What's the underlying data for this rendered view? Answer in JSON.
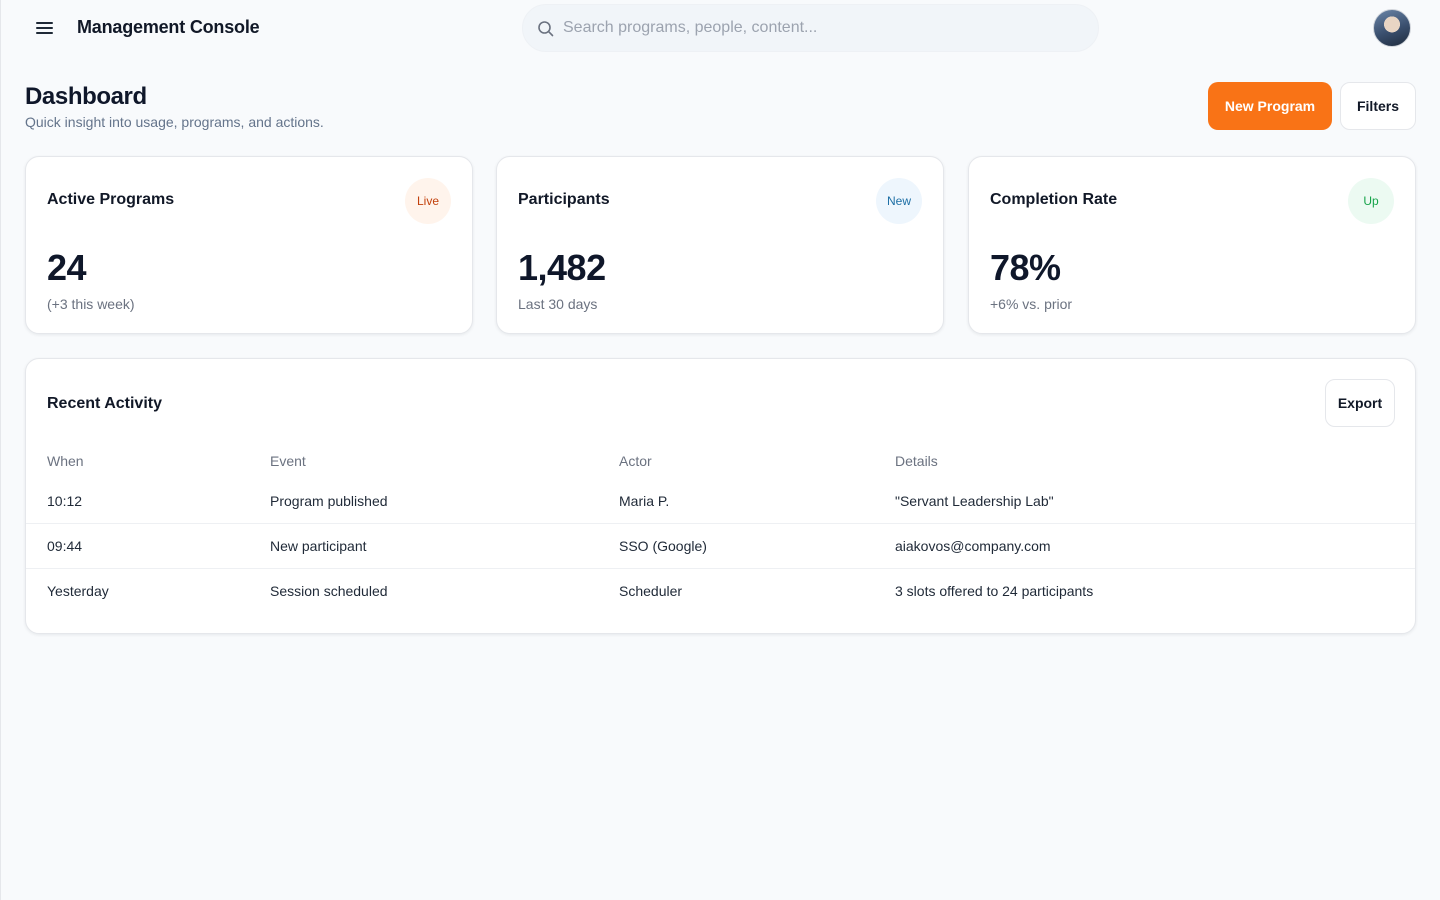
{
  "header": {
    "app_title": "Management Console",
    "search_placeholder": "Search programs, people, content...",
    "menu_icon": "hamburger-menu-icon",
    "search_icon": "search-icon",
    "avatar": "user-avatar"
  },
  "page": {
    "title": "Dashboard",
    "subtitle": "Quick insight into usage, programs, and actions.",
    "new_program_label": "New Program",
    "filters_label": "Filters"
  },
  "colors": {
    "accent": "#f97316",
    "background": "#f8fafc",
    "badge_live": "#c2410c",
    "badge_new": "#1d6fa5",
    "badge_up": "#16a34a"
  },
  "stats": [
    {
      "title": "Active Programs",
      "badge": "Live",
      "value": "24",
      "note": "(+3 this week)"
    },
    {
      "title": "Participants",
      "badge": "New",
      "value": "1,482",
      "note": "Last 30 days"
    },
    {
      "title": "Completion Rate",
      "badge": "Up",
      "value": "78%",
      "note": "+6% vs. prior"
    }
  ],
  "activity": {
    "title": "Recent Activity",
    "export_label": "Export",
    "columns": [
      "When",
      "Event",
      "Actor",
      "Details"
    ],
    "rows": [
      [
        "10:12",
        "Program published",
        "Maria P.",
        "\"Servant Leadership Lab\""
      ],
      [
        "09:44",
        "New participant",
        "SSO (Google)",
        "aiakovos@company.com"
      ],
      [
        "Yesterday",
        "Session scheduled",
        "Scheduler",
        "3 slots offered to 24 participants"
      ]
    ]
  }
}
